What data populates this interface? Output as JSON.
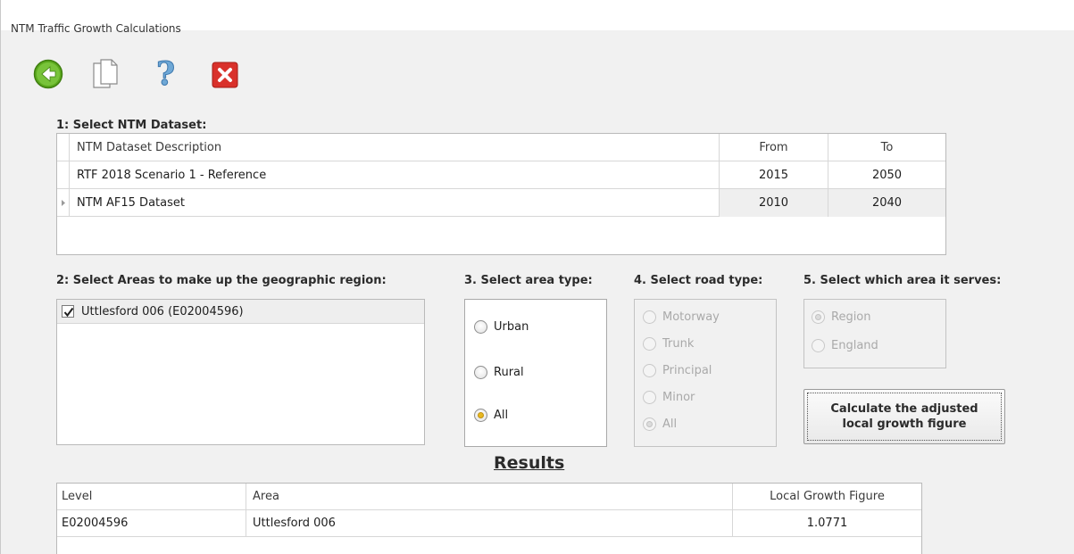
{
  "window": {
    "title": "NTM Traffic Growth Calculations"
  },
  "toolbar": {
    "icons": [
      "back-arrow-icon",
      "copy-icon",
      "help-icon",
      "close-icon"
    ]
  },
  "section1": {
    "label": "1: Select NTM Dataset:",
    "columns": [
      "NTM Dataset Description",
      "From",
      "To"
    ],
    "rows": [
      {
        "description": "RTF 2018 Scenario 1 - Reference",
        "from": "2015",
        "to": "2050"
      },
      {
        "description": "NTM AF15 Dataset",
        "from": "2010",
        "to": "2040"
      }
    ]
  },
  "section2": {
    "label": "2: Select Areas to make up the geographic region:",
    "items": [
      {
        "label": "Uttlesford 006 (E02004596)",
        "checked": true
      }
    ]
  },
  "section3": {
    "label": "3. Select area type:",
    "options": [
      "Urban",
      "Rural",
      "All"
    ],
    "selected": "All"
  },
  "section4": {
    "label": "4. Select road type:",
    "options": [
      "Motorway",
      "Trunk",
      "Principal",
      "Minor",
      "All"
    ],
    "selected": "All",
    "enabled": false
  },
  "section5": {
    "label": "5. Select which area it serves:",
    "options": [
      "Region",
      "England"
    ],
    "selected": "Region",
    "enabled": false
  },
  "calculate_button": {
    "line1": "Calculate the adjusted",
    "line2": "local growth figure"
  },
  "results": {
    "title": "Results",
    "columns": [
      "Level",
      "Area",
      "Local Growth Figure"
    ],
    "rows": [
      {
        "level": "E02004596",
        "area": "Uttlesford 006",
        "value": "1.0771"
      }
    ]
  },
  "colors": {
    "radio_selected": "#e8b820",
    "close_red": "#d9312b",
    "back_green": "#5caa1e"
  }
}
